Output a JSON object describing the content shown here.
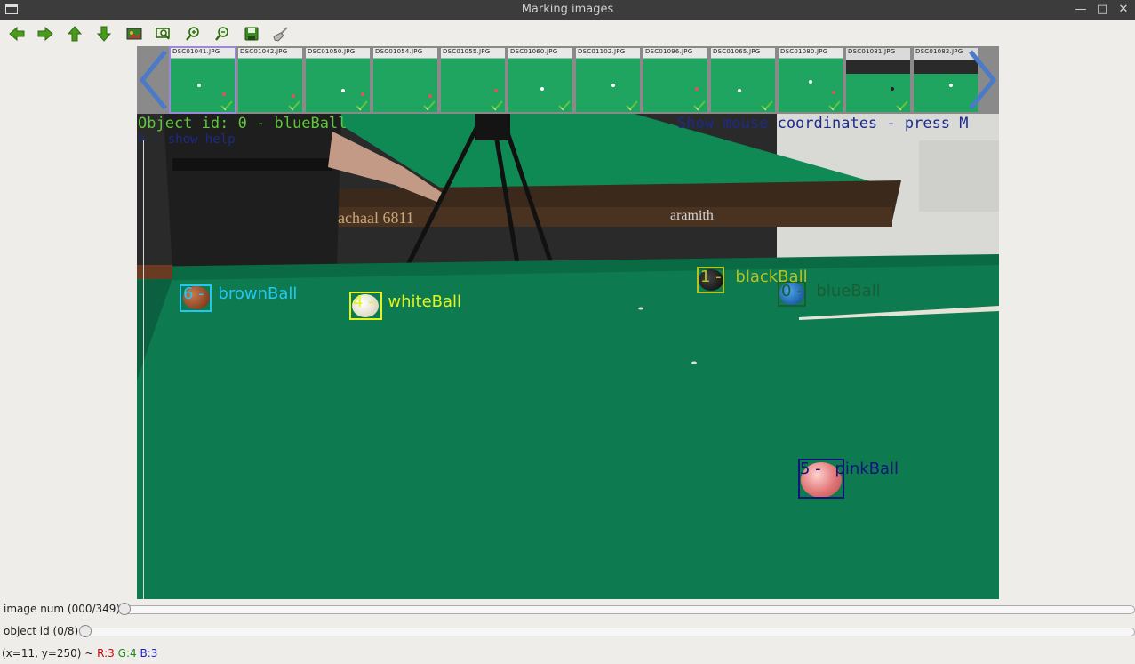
{
  "window": {
    "title": "Marking images"
  },
  "toolbar": {
    "buttons": [
      {
        "name": "prev-image-button",
        "icon": "arrow-left-icon"
      },
      {
        "name": "next-image-button",
        "icon": "arrow-right-icon"
      },
      {
        "name": "prev-object-button",
        "icon": "arrow-up-icon"
      },
      {
        "name": "next-object-button",
        "icon": "arrow-down-icon"
      },
      {
        "name": "view-image-button",
        "icon": "image-icon"
      },
      {
        "name": "zoom-fit-button",
        "icon": "zoom-fit-icon"
      },
      {
        "name": "zoom-in-button",
        "icon": "zoom-in-icon"
      },
      {
        "name": "zoom-out-button",
        "icon": "zoom-out-icon"
      },
      {
        "name": "save-button",
        "icon": "save-icon"
      },
      {
        "name": "clear-button",
        "icon": "broom-icon"
      }
    ]
  },
  "thumbnails": [
    {
      "label": "DSC01041.JPG"
    },
    {
      "label": "DSC01042.JPG"
    },
    {
      "label": "DSC01050.JPG"
    },
    {
      "label": "DSC01054.JPG"
    },
    {
      "label": "DSC01055.JPG"
    },
    {
      "label": "DSC01060.JPG"
    },
    {
      "label": "DSC01102.JPG"
    },
    {
      "label": "DSC01096.JPG"
    },
    {
      "label": "DSC01065.JPG"
    },
    {
      "label": "DSC01080.JPG"
    },
    {
      "label": "DSC01081.JPG"
    },
    {
      "label": "DSC01082.JPG"
    }
  ],
  "overlay": {
    "object_id": "Object id: 0   - blueBall",
    "help": "h - show help",
    "mouse_hint": "Show mouse coordinates - press M",
    "brand": "aramith",
    "rail_text": "rachaal 6811"
  },
  "annotations": [
    {
      "id": "6",
      "name": "brownBall",
      "color": "#27c6f0"
    },
    {
      "id": "4",
      "name": "whiteBall",
      "color": "#e6f21c"
    },
    {
      "id": "1",
      "name": "blackBall",
      "color": "#b9c21a"
    },
    {
      "id": "0",
      "name": "blueBall",
      "color": "#1b5d33"
    },
    {
      "id": "5",
      "name": "pinkBall",
      "color": "#14137a"
    }
  ],
  "sliders": {
    "image_num": {
      "label": "image num  (000/349)",
      "value": 0,
      "max": 349
    },
    "object_id": {
      "label": "object id  (0/8)",
      "value": 0,
      "max": 8
    }
  },
  "status": {
    "coords": "(x=11, y=250) ~ ",
    "r": "R:3",
    "g": "G:4",
    "b": "B:3"
  },
  "colors": {
    "accent": "#5aa02c",
    "table_felt": "#0d7a50",
    "status_r": "#cc0000",
    "status_g": "#1a8a1a",
    "status_b": "#1a1acc"
  }
}
